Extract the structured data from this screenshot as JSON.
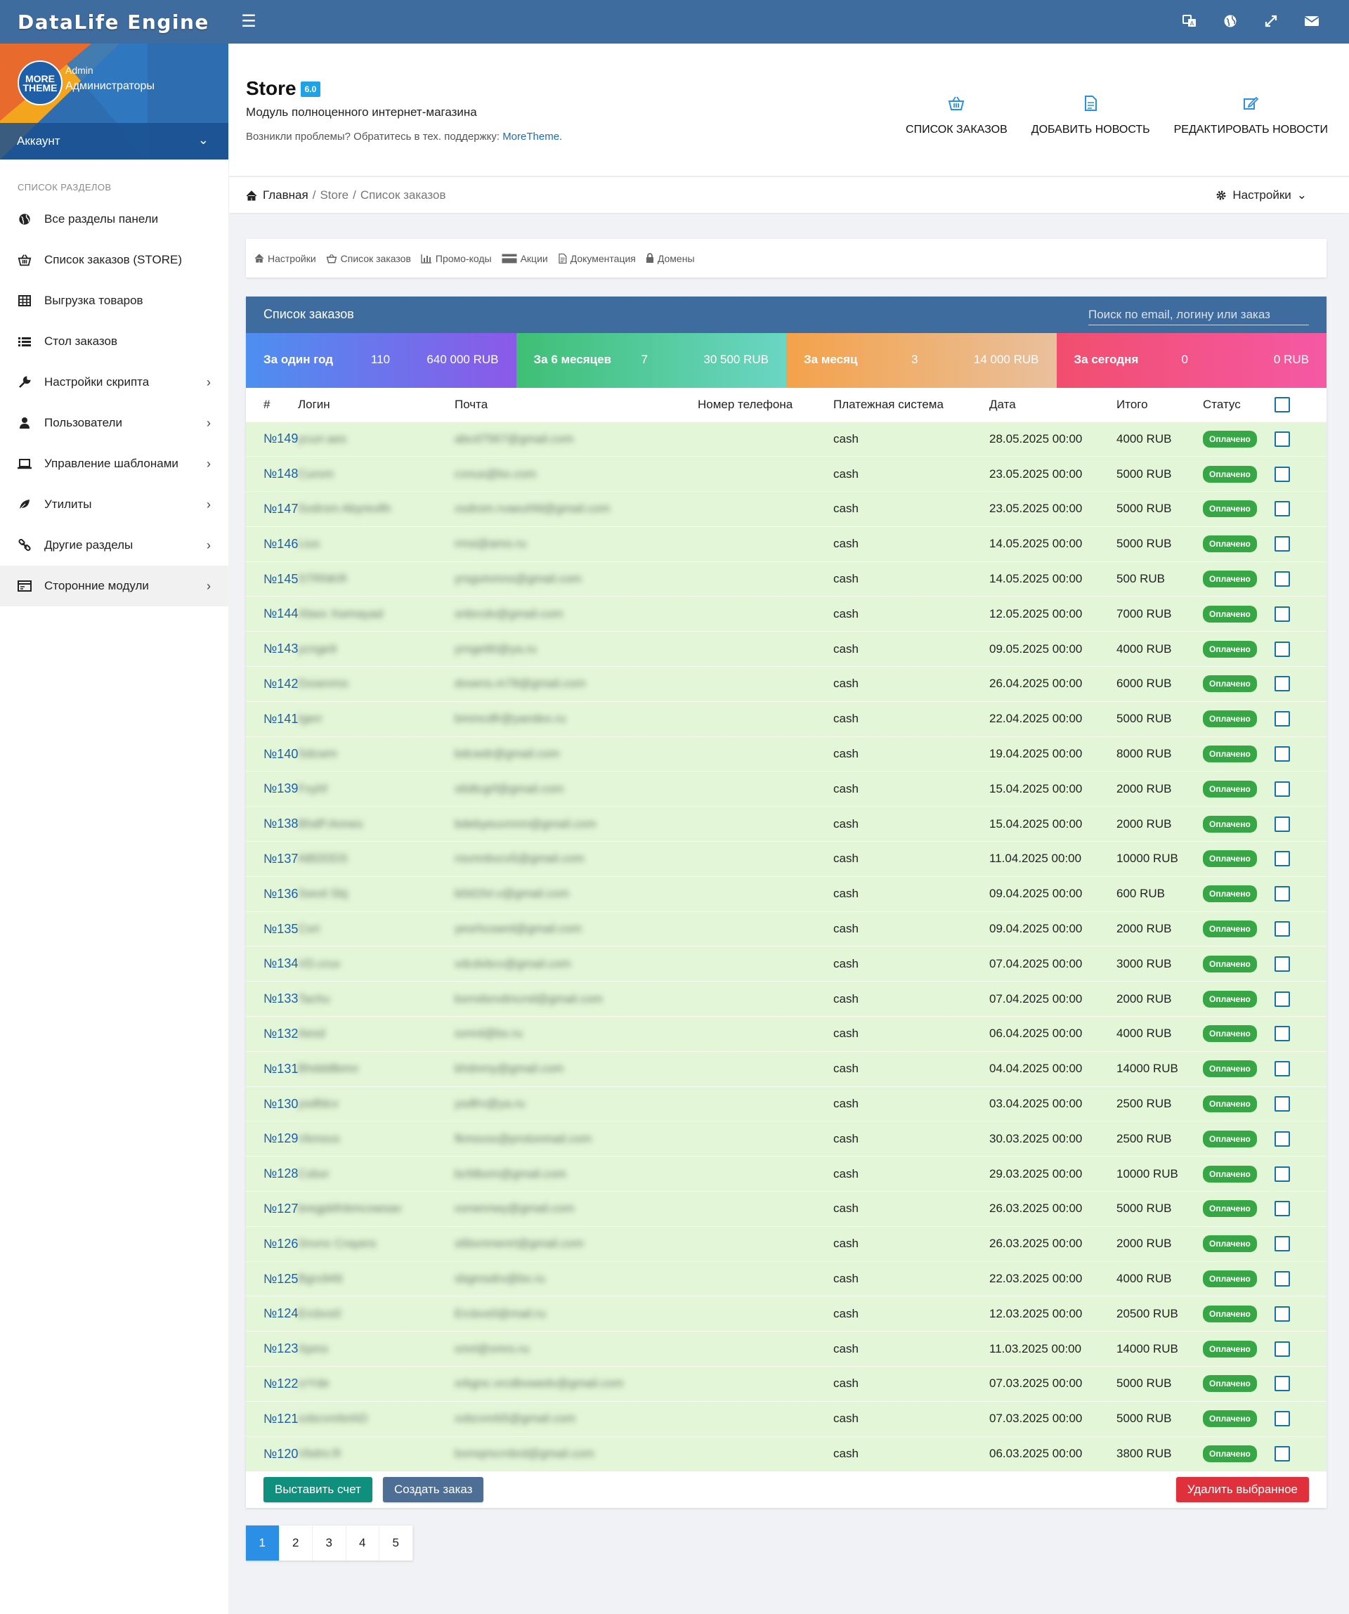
{
  "app": {
    "brand": "DataLife Engine"
  },
  "user": {
    "role": "Admin",
    "group": "Администраторы",
    "account_label": "Аккаунт",
    "avatar_text": "MORE THEME"
  },
  "sidebar": {
    "section_title": "СПИСОК РАЗДЕЛОВ",
    "items": [
      {
        "label": "Все разделы панели",
        "icon": "globe-icon",
        "arrow": false
      },
      {
        "label": "Список заказов (STORE)",
        "icon": "basket-icon",
        "arrow": false
      },
      {
        "label": "Выгрузка товаров",
        "icon": "table-icon",
        "arrow": false
      },
      {
        "label": "Стол заказов",
        "icon": "list-icon",
        "arrow": false
      },
      {
        "label": "Настройки скрипта",
        "icon": "wrench-icon",
        "arrow": true
      },
      {
        "label": "Пользователи",
        "icon": "user-icon",
        "arrow": true
      },
      {
        "label": "Управление шаблонами",
        "icon": "laptop-icon",
        "arrow": true
      },
      {
        "label": "Утилиты",
        "icon": "leaf-icon",
        "arrow": true
      },
      {
        "label": "Другие разделы",
        "icon": "link-icon",
        "arrow": true
      },
      {
        "label": "Сторонние модули",
        "icon": "module-icon",
        "arrow": true
      }
    ]
  },
  "header": {
    "title": "Store",
    "version": "6.0",
    "subtitle": "Модуль полноценного интернет-магазина",
    "help_text": "Возникли проблемы? Обратитесь в тех. поддержку:",
    "help_link": "MoreTheme.",
    "actions": [
      {
        "label": "СПИСОК ЗАКАЗОВ",
        "icon": "basket-icon"
      },
      {
        "label": "ДОБАВИТЬ НОВОСТЬ",
        "icon": "document-icon"
      },
      {
        "label": "РЕДАКТИРОВАТЬ НОВОСТИ",
        "icon": "edit-icon"
      }
    ]
  },
  "breadcrumb": {
    "home": "Главная",
    "items": [
      "Store",
      "Список заказов"
    ],
    "separator": "/",
    "settings_label": "Настройки"
  },
  "tabs": [
    {
      "label": "Настройки",
      "icon": "home-icon"
    },
    {
      "label": "Список заказов",
      "icon": "basket-icon"
    },
    {
      "label": "Промо-коды",
      "icon": "bar-chart-icon"
    },
    {
      "label": "Акции",
      "icon": "card-icon"
    },
    {
      "label": "Документация",
      "icon": "document-icon"
    },
    {
      "label": "Домены",
      "icon": "lock-icon"
    }
  ],
  "orders_panel": {
    "title": "Список заказов",
    "search_placeholder": "Поиск по email, логину или заказ",
    "stats": [
      {
        "label": "За один год",
        "count": "110",
        "sum": "640 000 RUB"
      },
      {
        "label": "За 6 месяцев",
        "count": "7",
        "sum": "30 500 RUB"
      },
      {
        "label": "За месяц",
        "count": "3",
        "sum": "14 000 RUB"
      },
      {
        "label": "За сегодня",
        "count": "0",
        "sum": "0 RUB"
      }
    ],
    "columns": [
      "#",
      "Логин",
      "Почта",
      "Номер телефона",
      "Платежная система",
      "Дата",
      "Итого",
      "Статус"
    ],
    "rows": [
      {
        "num": "№149",
        "login": "ycurr.aes",
        "email": "abcd7567@gmail.com",
        "phone": "",
        "payment": "cash",
        "date": "28.05.2025 00:00",
        "total": "4000 RUB",
        "status": "Оплачено"
      },
      {
        "num": "№148",
        "login": "Curom",
        "email": "cvnus@bx.com",
        "phone": "",
        "payment": "cash",
        "date": "23.05.2025 00:00",
        "total": "5000 RUB",
        "status": "Оплачено"
      },
      {
        "num": "№147",
        "login": "Sxdrom Abyrevllh",
        "email": "xsdrom.rvaeuhfd@gmail.com",
        "phone": "",
        "payment": "cash",
        "date": "23.05.2025 00:00",
        "total": "5000 RUB",
        "status": "Оплачено"
      },
      {
        "num": "№146",
        "login": "Lius",
        "email": "rmsi@amo.ru",
        "phone": "",
        "payment": "cash",
        "date": "14.05.2025 00:00",
        "total": "5000 RUB",
        "status": "Оплачено"
      },
      {
        "num": "№145",
        "login": "STRNKR",
        "email": "yrsgvinmns@gmail.com",
        "phone": "",
        "payment": "cash",
        "date": "14.05.2025 00:00",
        "total": "500 RUB",
        "status": "Оплачено"
      },
      {
        "num": "№144",
        "login": "Xbwx Xwmayad",
        "email": "snbrcdv@gmail.com",
        "phone": "",
        "payment": "cash",
        "date": "12.05.2025 00:00",
        "total": "7000 RUB",
        "status": "Оплачено"
      },
      {
        "num": "№143",
        "login": "ycnge9",
        "email": "yrnge90@ya.ru",
        "phone": "",
        "payment": "cash",
        "date": "09.05.2025 00:00",
        "total": "4000 RUB",
        "status": "Оплачено"
      },
      {
        "num": "№142",
        "login": "Dxsenmo",
        "email": "dxsens.m78@gmail.com",
        "phone": "",
        "payment": "cash",
        "date": "26.04.2025 00:00",
        "total": "6000 RUB",
        "status": "Оплачено"
      },
      {
        "num": "№141",
        "login": "Igerr",
        "email": "bmmcdfr@yandex.ru",
        "phone": "",
        "payment": "cash",
        "date": "22.04.2025 00:00",
        "total": "5000 RUB",
        "status": "Оплачено"
      },
      {
        "num": "№140",
        "login": "Sdcwm",
        "email": "bdcwdr@gmail.com",
        "phone": "",
        "payment": "cash",
        "date": "19.04.2025 00:00",
        "total": "8000 RUB",
        "status": "Оплачено"
      },
      {
        "num": "№139",
        "login": "Fxyhf",
        "email": "s6dtcgrf@gmail.com",
        "phone": "",
        "payment": "cash",
        "date": "15.04.2025 00:00",
        "total": "2000 RUB",
        "status": "Оплачено"
      },
      {
        "num": "№138",
        "login": "BhdP.Annes",
        "email": "bdebyeuvnnm@gmail.com",
        "phone": "",
        "payment": "cash",
        "date": "15.04.2025 00:00",
        "total": "2000 RUB",
        "status": "Оплачено"
      },
      {
        "num": "№137",
        "login": "ABDDDS",
        "email": "nsvnnbvcs5@gmail.com",
        "phone": "",
        "payment": "cash",
        "date": "11.04.2025 00:00",
        "total": "10000 RUB",
        "status": "Оплачено"
      },
      {
        "num": "№136",
        "login": "Swvd Sbj",
        "email": "b0d1fvl.v@gmail.com",
        "phone": "",
        "payment": "cash",
        "date": "09.04.2025 00:00",
        "total": "600 RUB",
        "status": "Оплачено"
      },
      {
        "num": "№135",
        "login": "Cori",
        "email": "yesrhcswrd@gmail.com",
        "phone": "",
        "payment": "cash",
        "date": "09.04.2025 00:00",
        "total": "2000 RUB",
        "status": "Оплачено"
      },
      {
        "num": "№134",
        "login": "VD.cruv",
        "email": "vdcdvbcv@gmail.com",
        "phone": "",
        "payment": "cash",
        "date": "07.04.2025 00:00",
        "total": "3000 RUB",
        "status": "Оплачено"
      },
      {
        "num": "№133",
        "login": "Tachu",
        "email": "bxrndsrvdmcnd@gmail.com",
        "phone": "",
        "payment": "cash",
        "date": "07.04.2025 00:00",
        "total": "2000 RUB",
        "status": "Оплачено"
      },
      {
        "num": "№132",
        "login": "Aesd",
        "email": "svnrd@bx.ru",
        "phone": "",
        "payment": "cash",
        "date": "06.04.2025 00:00",
        "total": "4000 RUB",
        "status": "Оплачено"
      },
      {
        "num": "№131",
        "login": "Bhdddlbmn",
        "email": "bhdnmy@gmail.com",
        "phone": "",
        "payment": "cash",
        "date": "04.04.2025 00:00",
        "total": "14000 RUB",
        "status": "Оплачено"
      },
      {
        "num": "№130",
        "login": "ysdfdcv",
        "email": "ysdfrv@ya.ru",
        "phone": "",
        "payment": "cash",
        "date": "03.04.2025 00:00",
        "total": "2500 RUB",
        "status": "Оплачено"
      },
      {
        "num": "№129",
        "login": "Vkmsvs",
        "email": "fkmsvsx@protonmail.com",
        "phone": "",
        "payment": "cash",
        "date": "30.03.2025 00:00",
        "total": "2500 RUB",
        "status": "Оплачено"
      },
      {
        "num": "№128",
        "login": "Cxbxr",
        "email": "bcfdbxm@gmail.com",
        "phone": "",
        "payment": "cash",
        "date": "29.03.2025 00:00",
        "total": "10000 RUB",
        "status": "Оплачено"
      },
      {
        "num": "№127",
        "login": "bregpbfnbmcowsav",
        "email": "xorwnnwy@gmail.com",
        "phone": "",
        "payment": "cash",
        "date": "26.03.2025 00:00",
        "total": "5000 RUB",
        "status": "Оплачено"
      },
      {
        "num": "№126",
        "login": "Snvnx Crayers",
        "email": "s6bvnmenrt@gmail.com",
        "phone": "",
        "payment": "cash",
        "date": "26.03.2025 00:00",
        "total": "2000 RUB",
        "status": "Оплачено"
      },
      {
        "num": "№125",
        "login": "Bgrx949",
        "email": "sbgmsdrx@bx.ru",
        "phone": "",
        "payment": "cash",
        "date": "22.03.2025 00:00",
        "total": "4000 RUB",
        "status": "Оплачено"
      },
      {
        "num": "№124",
        "login": "Ercbvs0",
        "email": "Ercbvs0@mail.ru",
        "phone": "",
        "payment": "cash",
        "date": "12.03.2025 00:00",
        "total": "20500 RUB",
        "status": "Оплачено"
      },
      {
        "num": "№123",
        "login": "Xpmx",
        "email": "xmrl@xmrs.ru",
        "phone": "",
        "payment": "cash",
        "date": "11.03.2025 00:00",
        "total": "14000 RUB",
        "status": "Оплачено"
      },
      {
        "num": "№122",
        "login": "crYde",
        "email": "xrbgnc.vrcdbvwedv@gmail.com",
        "phone": "",
        "payment": "cash",
        "date": "07.03.2025 00:00",
        "total": "5000 RUB",
        "status": "Оплачено"
      },
      {
        "num": "№121",
        "login": "xxbcvnrbnhD",
        "email": "xxbcvnrb5@gmail.com",
        "phone": "",
        "payment": "cash",
        "date": "07.03.2025 00:00",
        "total": "5000 RUB",
        "status": "Оплачено"
      },
      {
        "num": "№120",
        "login": "Vbdnr.R",
        "email": "bxmqmcrnbrd@gmail.com",
        "phone": "",
        "payment": "cash",
        "date": "06.03.2025 00:00",
        "total": "3800 RUB",
        "status": "Оплачено"
      }
    ],
    "buttons": {
      "invoice": "Выставить счет",
      "create": "Создать заказ",
      "delete": "Удалить выбранное"
    }
  },
  "pagination": {
    "pages": [
      "1",
      "2",
      "3",
      "4",
      "5"
    ],
    "current": "1"
  },
  "colors": {
    "navbar": "#3f6c9e",
    "paid_badge": "#37a745",
    "row_bg": "#e3f6d7",
    "link": "#1f5fa8"
  }
}
